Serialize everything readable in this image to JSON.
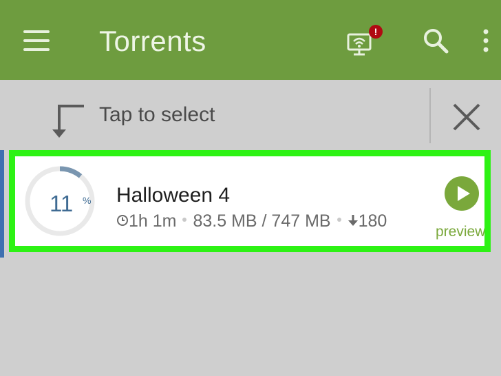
{
  "appbar": {
    "title": "Torrents",
    "menu_icon": "hamburger-menu-icon",
    "remote_icon": "remote-wifi-icon",
    "remote_badge": "!",
    "search_icon": "search-icon",
    "more_icon": "more-vert-icon",
    "color": "#6e9c3f"
  },
  "select_bar": {
    "icon": "tap-select-arrow-icon",
    "label": "Tap to select",
    "close_icon": "close-icon"
  },
  "torrents": [
    {
      "progress_value": "11",
      "progress_unit": "%",
      "progress_fraction": 0.11,
      "name": "Halloween 4",
      "eta": "1h 1m",
      "size": "83.5 MB / 747 MB",
      "peers": "180",
      "preview_label": "preview",
      "highlight_color": "#2df214"
    }
  ]
}
